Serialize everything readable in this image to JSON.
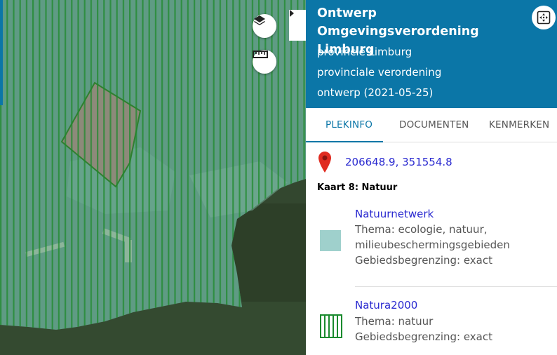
{
  "header": {
    "title": "Ontwerp Omgevingsverordening Limburg",
    "authority": "provincie Limburg",
    "doc_type": "provinciale verordening",
    "status": "ontwerp (2021-05-25)"
  },
  "tabs": [
    {
      "label": "PLEKINFO",
      "active": true
    },
    {
      "label": "DOCUMENTEN",
      "active": false
    },
    {
      "label": "KENMERKEN",
      "active": false
    }
  ],
  "location": {
    "coords": "206648.9, 351554.8",
    "icon": "map-pin-icon"
  },
  "section_title": "Kaart 8: Natuur",
  "items": [
    {
      "title": "Natuurnetwerk",
      "theme": "Thema: ecologie, natuur,",
      "theme_cont": "milieubeschermingsgebieden",
      "boundary": "Gebiedsbegrenzing: exact",
      "legend_color": "#9fd0cc"
    },
    {
      "title": "Natura2000",
      "theme": "Thema: natuur",
      "boundary": "Gebiedsbegrenzing: exact",
      "legend_color": "#1a8a2e"
    }
  ],
  "colors": {
    "header": "#0b76a7",
    "link": "#2a2ad0",
    "hatch": "#1f8a2c"
  },
  "map_controls": [
    "layers-icon",
    "ruler-icon",
    "chevron-right-icon",
    "fullscreen-icon"
  ]
}
